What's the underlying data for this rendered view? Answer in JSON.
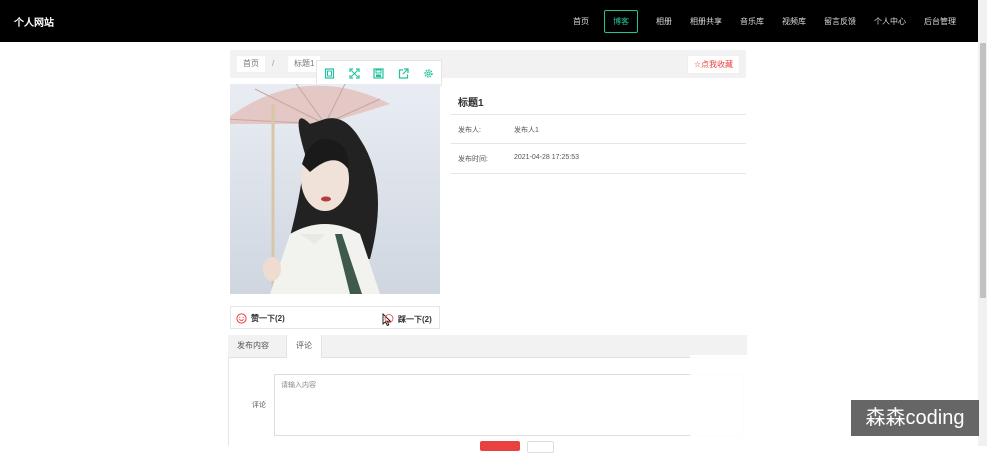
{
  "brand": "个人网站",
  "nav": {
    "items": [
      "首页",
      "博客",
      "相册",
      "相册共享",
      "音乐库",
      "视频库",
      "留言反馈",
      "个人中心",
      "后台管理"
    ],
    "active": "博客"
  },
  "breadcrumb": {
    "home": "首页",
    "sep": "/",
    "current": "标题1"
  },
  "favorite_label": "☆点我收藏",
  "toolbar_icons": [
    "frame-icon",
    "fullscreen-icon",
    "save-icon",
    "share-icon",
    "settings-icon"
  ],
  "post": {
    "title": "标题1",
    "publisher_label": "发布人:",
    "publisher_value": "发布人1",
    "time_label": "发布时间:",
    "time_value": "2021-04-28 17:25:53"
  },
  "votes": {
    "like_label": "赞一下(2)",
    "dislike_label": "踩一下(2)"
  },
  "tabs": {
    "content": "发布内容",
    "comment": "评论"
  },
  "comment": {
    "label": "评论",
    "placeholder": "请输入内容"
  },
  "watermark": "森森coding",
  "colors": {
    "accent": "#21c39b",
    "danger": "#e94040",
    "nav_bg": "#000000"
  }
}
